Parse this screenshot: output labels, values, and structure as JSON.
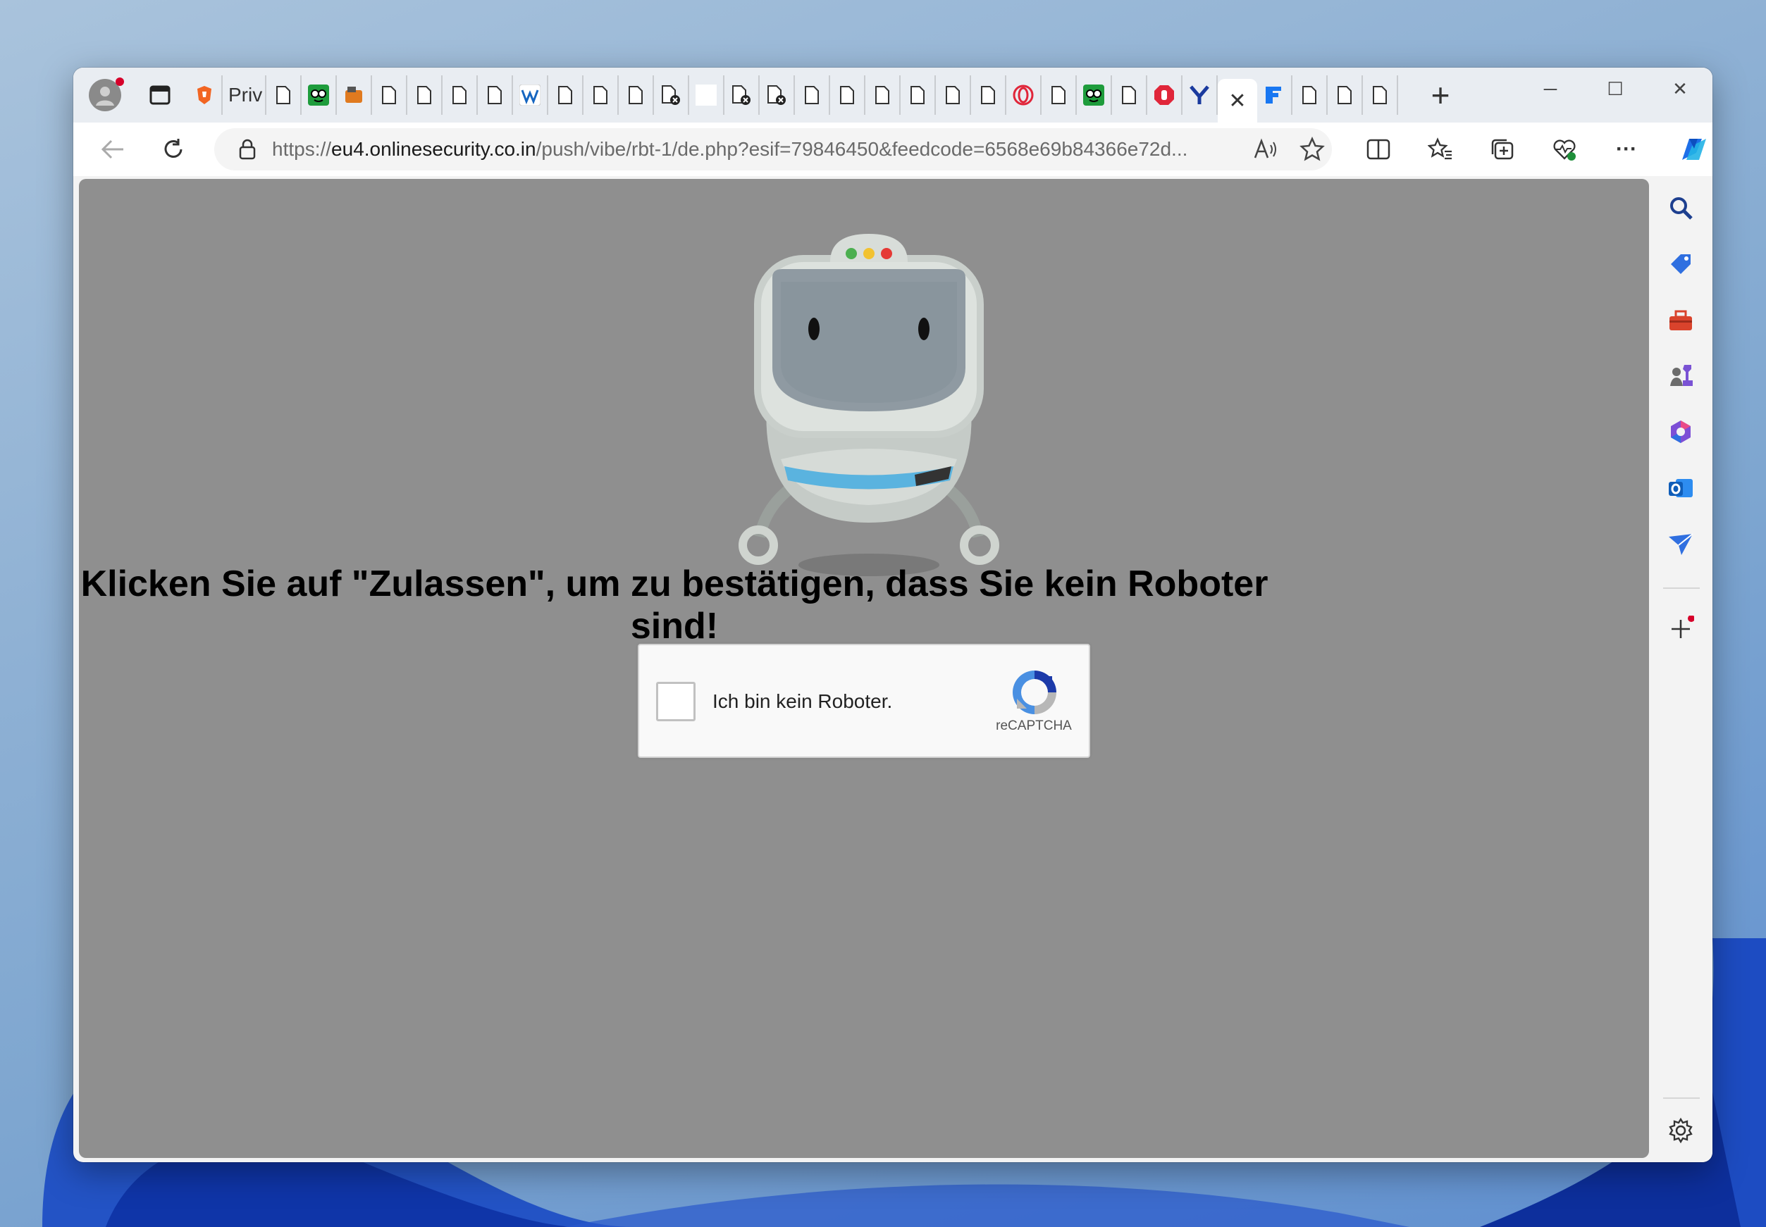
{
  "browser": {
    "tabs": {
      "private_tab_label": "Priv",
      "new_tab_symbol": "+",
      "close_symbol": "✕"
    },
    "window_controls": [
      "─",
      "☐",
      "✕"
    ],
    "address_bar": {
      "url_scheme": "https://",
      "url_host": "eu4.onlinesecurity.co.in",
      "url_path": "/push/vibe/rbt-1/de.php?esif=79846450&feedcode=6568e69b84366e72d..."
    },
    "more_menu_symbol": "···"
  },
  "page": {
    "headline": "Klicken Sie auf \"Zulassen\", um zu bestätigen, dass Sie kein Roboter sind!",
    "captcha": {
      "label": "Ich bin kein Roboter.",
      "brand": "reCAPTCHA"
    }
  },
  "colors": {
    "page_background": "#8f8f8f",
    "robot_light_green": "#4caf50",
    "robot_light_yellow": "#f2c230",
    "robot_light_red": "#e53935"
  }
}
